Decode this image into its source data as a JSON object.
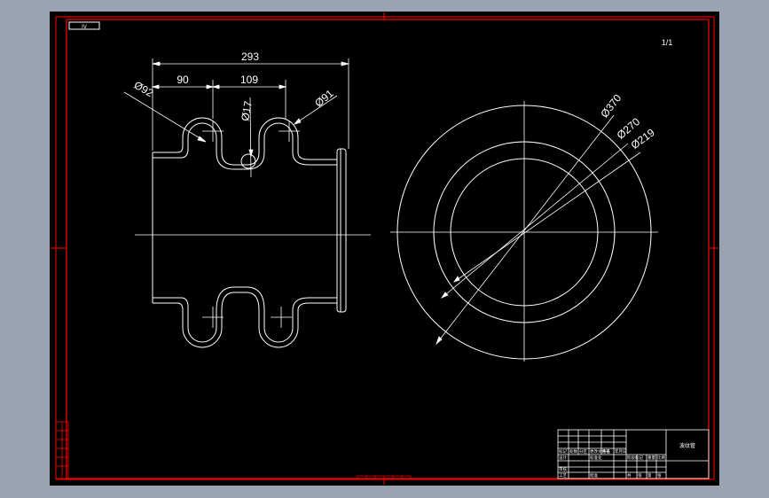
{
  "drawing": {
    "sheet_tag": "IV",
    "note": "1/1",
    "dimensions": {
      "overall_width": "293",
      "left_span": "90",
      "right_span": "109",
      "dia_left_convolution": "Ø92",
      "dia_right_convolution": "Ø91",
      "dia_small": "Ø17",
      "dia_outer": "Ø370",
      "dia_middle": "Ø270",
      "dia_inner": "Ø219"
    },
    "title_block": {
      "part_name": "波纹管",
      "labels": [
        "标记",
        "处数",
        "分区",
        "更改文件号",
        "签名",
        "年月日",
        "设计",
        "标准化",
        "阶段标记",
        "重量",
        "比例",
        "审核",
        "工艺",
        "批准",
        "共",
        "张",
        "第",
        "张"
      ]
    },
    "colors": {
      "canvas": "#000000",
      "frame": "#ff0000",
      "lines": "#ffffff",
      "background": "#9aa3b1"
    }
  }
}
